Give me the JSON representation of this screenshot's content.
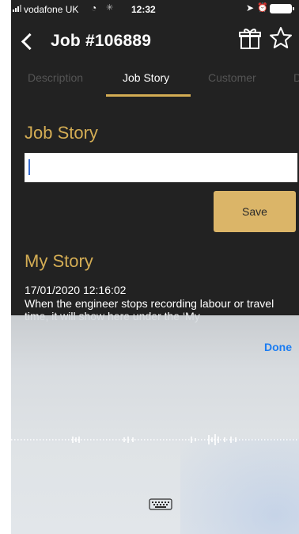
{
  "status_bar": {
    "carrier": "vodafone UK",
    "time": "12:32"
  },
  "header": {
    "title": "Job #106889",
    "icons": [
      "back-chevron-icon",
      "gift-icon",
      "star-icon"
    ]
  },
  "tabs": [
    {
      "label": "Description",
      "active": false
    },
    {
      "label": "Job Story",
      "active": true
    },
    {
      "label": "Customer",
      "active": false
    },
    {
      "label": "D",
      "active": false
    }
  ],
  "job_story": {
    "heading": "Job Story",
    "input_value": "",
    "save_label": "Save"
  },
  "my_story": {
    "heading": "My Story",
    "date": "17/01/2020 12:16:02",
    "body": "When the engineer stops recording labour or travel time, it will show here under the ‘My"
  },
  "dictation": {
    "done_label": "Done"
  },
  "colors": {
    "background": "#222222",
    "accent": "#d4ad54",
    "save_button": "#dbb568",
    "done": "#1a7cf2"
  }
}
